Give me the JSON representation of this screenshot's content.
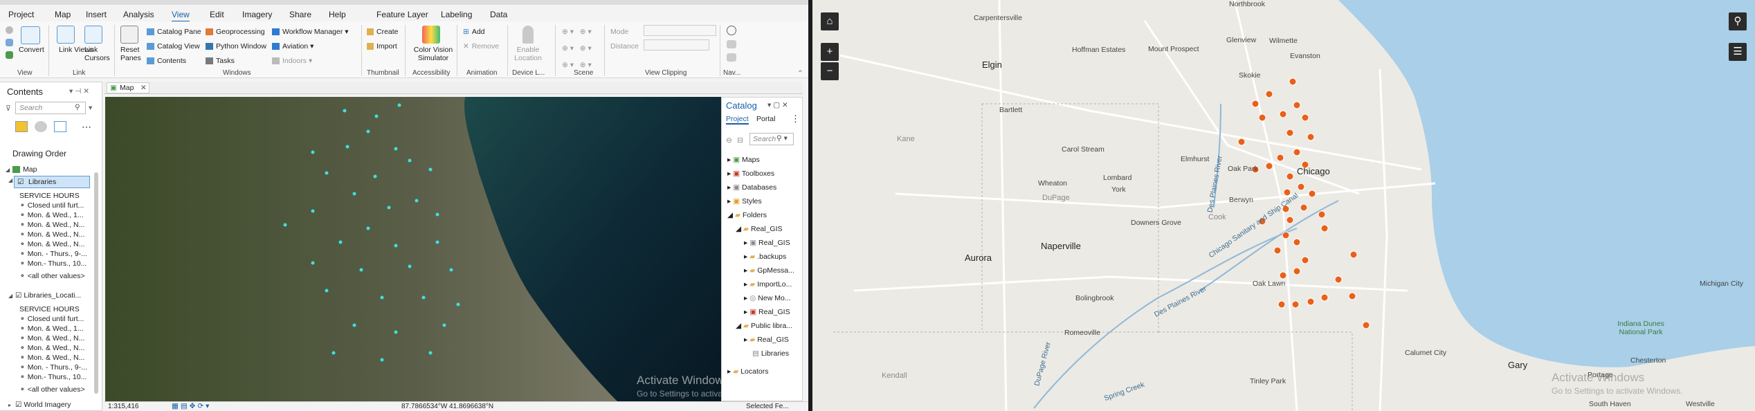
{
  "ribbon": {
    "tabs": [
      "Project",
      "Map",
      "Insert",
      "Analysis",
      "View",
      "Edit",
      "Imagery",
      "Share",
      "Help",
      "Feature Layer",
      "Labeling",
      "Data"
    ],
    "active_tab": "View",
    "view_group": {
      "convert": "Convert",
      "label": "View"
    },
    "link_group": {
      "link_views": "Link Views",
      "link_cursors": "Link Cursors",
      "label": "Link"
    },
    "windows_group": {
      "reset_panes": "Reset Panes",
      "catalog_pane": "Catalog Pane",
      "catalog_view": "Catalog View",
      "contents": "Contents",
      "geoprocessing": "Geoprocessing",
      "python_window": "Python Window",
      "tasks": "Tasks",
      "workflow_manager": "Workflow Manager",
      "aviation": "Aviation",
      "indoors": "Indoors",
      "label": "Windows"
    },
    "thumbnail_group": {
      "create": "Create",
      "import": "Import",
      "label": "Thumbnail"
    },
    "accessibility_group": {
      "cvs": "Color Vision Simulator",
      "label": "Accessibility"
    },
    "animation_group": {
      "add": "Add",
      "remove": "Remove",
      "label": "Animation"
    },
    "device_group": {
      "enable_location": "Enable Location",
      "label": "Device L..."
    },
    "scene_group": {
      "label": "Scene"
    },
    "clipping_group": {
      "mode": "Mode",
      "distance": "Distance",
      "label": "View Clipping"
    },
    "nav_group": {
      "label": "Nav..."
    }
  },
  "contents": {
    "title": "Contents",
    "search_placeholder": "Search",
    "drawing_order": "Drawing Order",
    "map": "Map",
    "layer1": "Libraries",
    "layer2": "Libraries_Locati...",
    "service_hours": "SERVICE HOURS",
    "values": [
      "Closed until furt...",
      "Mon. & Wed., 1...",
      "Mon. & Wed., N...",
      "Mon. & Wed., N...",
      "Mon. & Wed., N...",
      "Mon. - Thurs., 9-...",
      "Mon.- Thurs., 10..."
    ],
    "other_values": "<all other values>",
    "world_imagery": "World Imagery"
  },
  "map_view": {
    "tab": "Map",
    "scale": "1:315,416",
    "coords": "87.7866534°W 41.8696638°N",
    "selected": "Selected Fe...",
    "watermark_title": "Activate Windows",
    "watermark_sub": "Go to Settings to activate Windows."
  },
  "catalog": {
    "title": "Catalog",
    "tab_project": "Project",
    "tab_portal": "Portal",
    "search_placeholder": "Search",
    "items": [
      "Maps",
      "Toolboxes",
      "Databases",
      "Styles",
      "Folders",
      "Real_GIS",
      "Real_GIS",
      ".backups",
      "GpMessa...",
      "ImportLo...",
      "New Mo...",
      "Real_GIS",
      "Public libra...",
      "Real_GIS",
      "Libraries",
      "Locators"
    ]
  },
  "web_map": {
    "labels": {
      "northbrook": "Northbrook",
      "carpentersville": "Carpentersville",
      "glenview": "Glenview",
      "wilmette": "Wilmette",
      "evanston": "Evanston",
      "hoffman": "Hoffman Estates",
      "mtprospect": "Mount Prospect",
      "skokie": "Skokie",
      "elgin": "Elgin",
      "bartlett": "Bartlett",
      "kane": "Kane",
      "carolstream": "Carol Stream",
      "elmhurst": "Elmhurst",
      "oakpark": "Oak Park",
      "chicago": "Chicago",
      "wheaton": "Wheaton",
      "lombard": "Lombard",
      "york": "York",
      "dupage": "DuPage",
      "berwyn": "Berwyn",
      "cook": "Cook",
      "downers": "Downers Grove",
      "naperville": "Naperville",
      "aurora": "Aurora",
      "oaklawn": "Oak Lawn",
      "bolingbrook": "Bolingbrook",
      "romeoville": "Romeoville",
      "kendall": "Kendall",
      "calumet": "Calumet City",
      "gary": "Gary",
      "tinley": "Tinley Park",
      "portage": "Portage",
      "chesterton": "Chesterton",
      "dunes": "Indiana Dunes National Park",
      "southhaven": "South Haven",
      "westville": "Westville",
      "michigancity": "Michigan City",
      "desplaines": "Des Plaines River",
      "canal": "Chicago Sanitary and Ship Canal",
      "dupageriver": "DuPage River",
      "springcreek": "Spring Creek",
      "dupageriver2": "Des Plaines River"
    },
    "watermark_title": "Activate Windows",
    "watermark_sub": "Go to Settings to activate Windows."
  },
  "colors": {
    "accent": "#1a5fa8",
    "lake": "#a9cfe9",
    "land": "#eceae4",
    "marker": "#e8611a",
    "marker_dot": "#3ee0e0"
  }
}
